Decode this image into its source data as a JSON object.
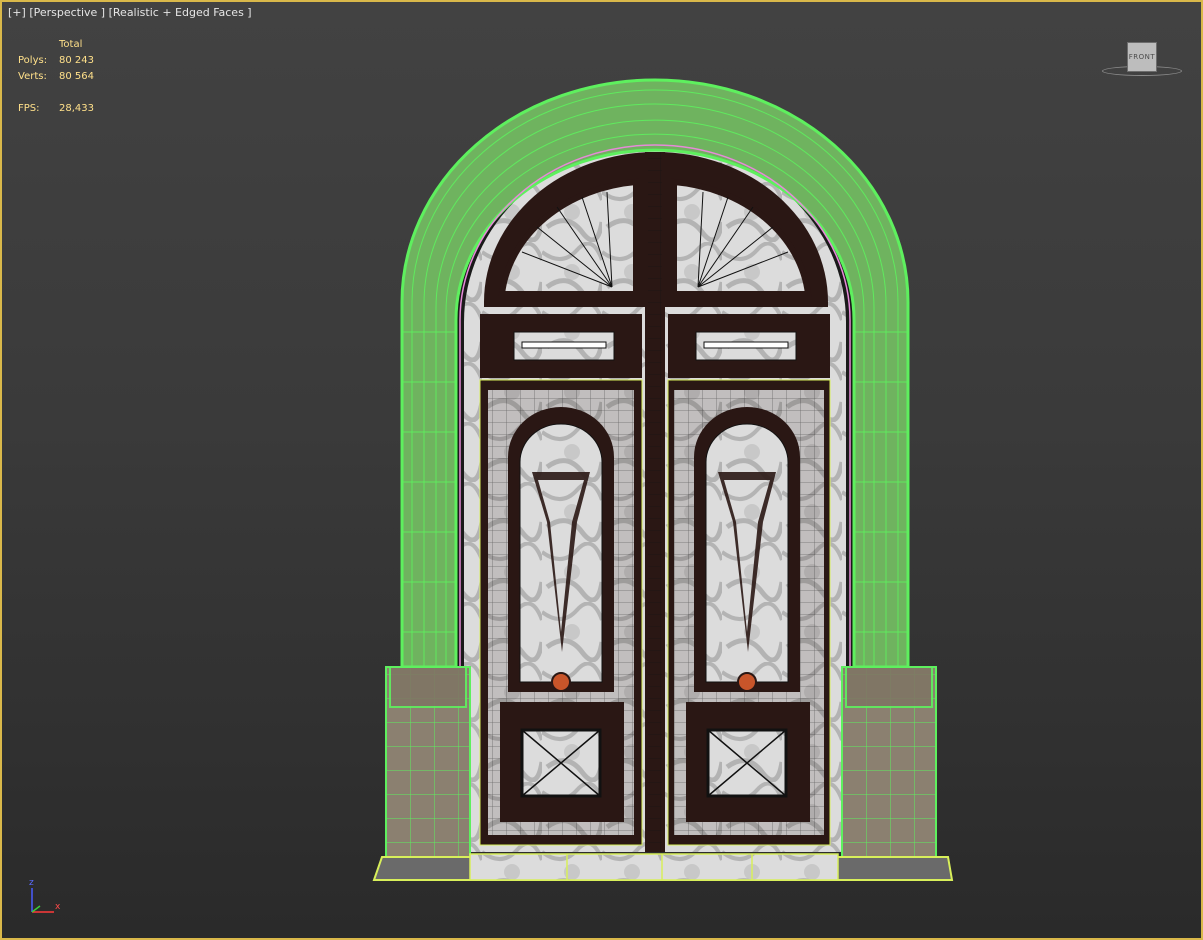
{
  "viewport": {
    "label_plus": "[+]",
    "label_view": "[Perspective ]",
    "label_shading": "[Realistic + Edged Faces ]"
  },
  "stats": {
    "header": "Total",
    "polys_label": "Polys:",
    "polys_value": "80 243",
    "verts_label": "Verts:",
    "verts_value": "80 564",
    "fps_label": "FPS:",
    "fps_value": "28,433"
  },
  "viewcube": {
    "face_label": "FRONT"
  },
  "axis_gizmo": {
    "z_label": "z",
    "x_label": "x"
  },
  "colors": {
    "frame_border": "#d9b84a",
    "selection_wire": "#5ef05e",
    "stats_text": "#ffe08a",
    "door_wood": "#2a1714",
    "marble": "#d8d8d8",
    "knob": "#c8552a"
  }
}
